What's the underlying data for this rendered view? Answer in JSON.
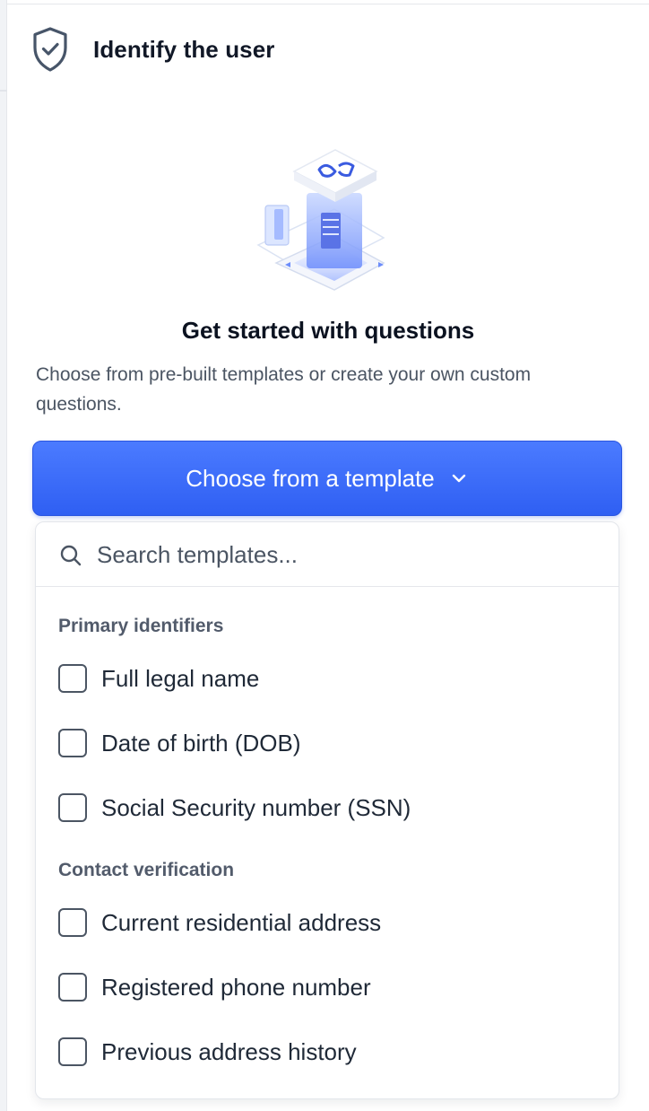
{
  "header": {
    "title": "Identify the user",
    "icon": "shield-check-icon"
  },
  "intro": {
    "heading": "Get started with questions",
    "description": "Choose from pre-built templates or create your own custom questions."
  },
  "cta": {
    "label": "Choose from a template",
    "icon": "chevron-down-icon"
  },
  "search": {
    "placeholder": "Search templates...",
    "value": "",
    "icon": "search-icon"
  },
  "groups": [
    {
      "title": "Primary identifiers",
      "options": [
        {
          "label": "Full legal name",
          "checked": false
        },
        {
          "label": "Date of birth (DOB)",
          "checked": false
        },
        {
          "label": "Social Security number (SSN)",
          "checked": false
        }
      ]
    },
    {
      "title": "Contact verification",
      "options": [
        {
          "label": "Current residential address",
          "checked": false
        },
        {
          "label": "Registered phone number",
          "checked": false
        },
        {
          "label": "Previous address history",
          "checked": false
        }
      ]
    }
  ],
  "colors": {
    "accent": "#3366F7",
    "heading": "#0B1220",
    "muted": "#4B5563"
  }
}
